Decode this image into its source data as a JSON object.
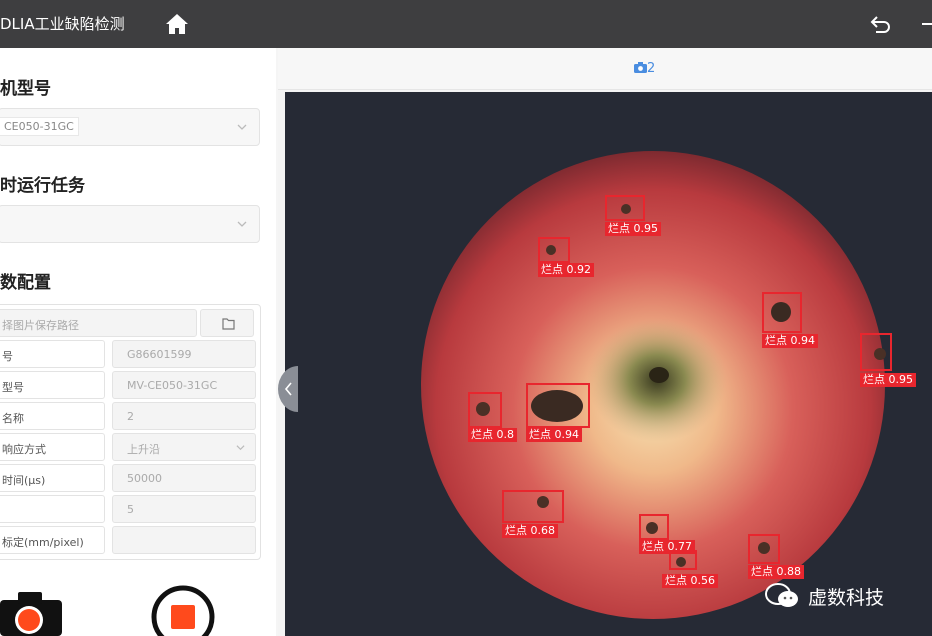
{
  "app": {
    "title": "DLIA工业缺陷检测"
  },
  "left": {
    "camera_model": {
      "title": "机型号",
      "value": "CE050-31GC"
    },
    "task": {
      "title": "时运行任务",
      "value": ""
    },
    "params": {
      "title": "数配置",
      "save_path_placeholder": "择图片保存路径",
      "rows": [
        {
          "label": "号",
          "value": "G86601599",
          "dropdown": false
        },
        {
          "label": "型号",
          "value": "MV-CE050-31GC",
          "dropdown": false
        },
        {
          "label": "名称",
          "value": "2",
          "dropdown": false
        },
        {
          "label": "响应方式",
          "value": "上升沿",
          "dropdown": true
        },
        {
          "label": "时间(μs)",
          "value": "50000",
          "dropdown": false
        },
        {
          "label": "",
          "value": "5",
          "dropdown": false
        },
        {
          "label": "标定(mm/pixel)",
          "value": "",
          "dropdown": false
        }
      ]
    }
  },
  "right": {
    "tab_label": "2",
    "detections": [
      {
        "label": "烂点 0.95"
      },
      {
        "label": "烂点 0.92"
      },
      {
        "label": "烂点 0.94"
      },
      {
        "label": "烂点 0.95"
      },
      {
        "label": "烂点 0.8"
      },
      {
        "label": "烂点 0.94"
      },
      {
        "label": "烂点 0.68"
      },
      {
        "label": "烂点 0.77"
      },
      {
        "label": "烂点 0.56"
      },
      {
        "label": "烂点 0.88"
      }
    ],
    "watermark": "虚数科技"
  },
  "colors": {
    "topbar": "#3e3e40",
    "accent_blue": "#4a8de0",
    "detection_red": "#e8262e",
    "record_orange": "#ff4a1c"
  },
  "icons": [
    "home-icon",
    "undo-icon",
    "minus-icon",
    "chevron-down-icon",
    "folder-icon",
    "camera-icon",
    "stop-icon",
    "collapse-arrow-icon",
    "wechat-icon"
  ]
}
